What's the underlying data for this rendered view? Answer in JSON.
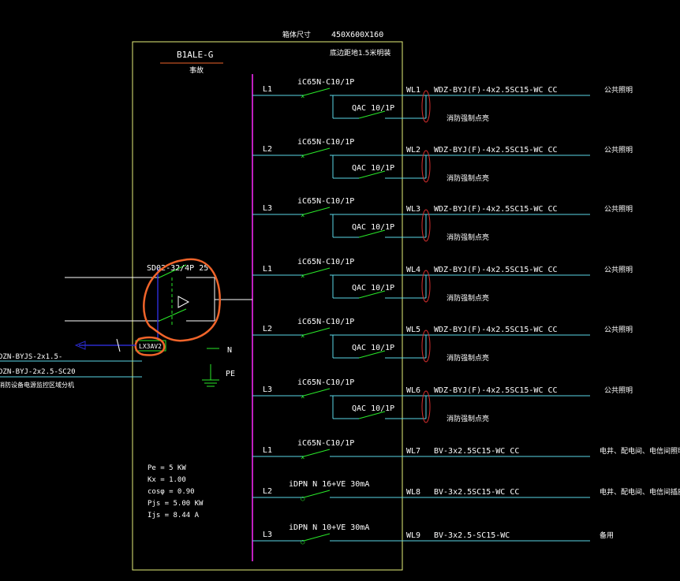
{
  "colors": {
    "background": "#000000",
    "frame": "#e6f07a",
    "busbar": "#c020c0",
    "breaker": "#29e829",
    "cable": "#5ad6e6",
    "oval": "#d93030",
    "annotation": "#f0642a",
    "incoming": "#2a2acc",
    "text": "#ffffff"
  },
  "header": {
    "box_size_label": "箱体尺寸",
    "box_size_value": "450X600X160",
    "mounting": "底边距地1.5米明装"
  },
  "panel": {
    "id": "B1ALE-G",
    "subtitle": "事故"
  },
  "main_switch": {
    "label": "SD02-32/4P  25",
    "tag": "LX3AV2"
  },
  "labels": {
    "neutral": "N",
    "earth": "PE"
  },
  "incoming": {
    "line1": "DZN-BYJS-2x1.5-",
    "line2": "DZN-BYJ-2x2.5-SC20",
    "line3": "消防设备电源监控区域分机"
  },
  "load_calc": [
    "Pe = 5 KW",
    "Kx = 1.00",
    "cosφ = 0.90",
    "Pjs = 5.00 KW",
    "Ijs = 8.44 A"
  ],
  "circuits": [
    {
      "phase": "L1",
      "breaker": "iC65N-C10/1P",
      "contactor": "QAC 10/1P",
      "contactor_note": "消防强制点亮",
      "wl": "WL1",
      "cable": "WDZ-BYJ(F)-4x2.5SC15-WC CC",
      "load": "公共照明"
    },
    {
      "phase": "L2",
      "breaker": "iC65N-C10/1P",
      "contactor": "QAC 10/1P",
      "contactor_note": "消防强制点亮",
      "wl": "WL2",
      "cable": "WDZ-BYJ(F)-4x2.5SC15-WC CC",
      "load": "公共照明"
    },
    {
      "phase": "L3",
      "breaker": "iC65N-C10/1P",
      "contactor": "QAC 10/1P",
      "contactor_note": "消防强制点亮",
      "wl": "WL3",
      "cable": "WDZ-BYJ(F)-4x2.5SC15-WC CC",
      "load": "公共照明"
    },
    {
      "phase": "L1",
      "breaker": "iC65N-C10/1P",
      "contactor": "QAC 10/1P",
      "contactor_note": "消防强制点亮",
      "wl": "WL4",
      "cable": "WDZ-BYJ(F)-4x2.5SC15-WC CC",
      "load": "公共照明"
    },
    {
      "phase": "L2",
      "breaker": "iC65N-C10/1P",
      "contactor": "QAC 10/1P",
      "contactor_note": "消防强制点亮",
      "wl": "WL5",
      "cable": "WDZ-BYJ(F)-4x2.5SC15-WC CC",
      "load": "公共照明"
    },
    {
      "phase": "L3",
      "breaker": "iC65N-C10/1P",
      "contactor": "QAC 10/1P",
      "contactor_note": "消防强制点亮",
      "wl": "WL6",
      "cable": "WDZ-BYJ(F)-4x2.5SC15-WC CC",
      "load": "公共照明"
    },
    {
      "phase": "L1",
      "breaker": "iC65N-C10/1P",
      "contactor": "",
      "contactor_note": "",
      "wl": "WL7",
      "cable": "BV-3x2.5SC15-WC CC",
      "load": "电井、配电间、电信间照明"
    },
    {
      "phase": "L2",
      "breaker": "iDPN N 16+VE 30mA",
      "contactor": "",
      "contactor_note": "",
      "wl": "WL8",
      "cable": "BV-3x2.5SC15-WC CC",
      "load": "电井、配电间、电信间插座"
    },
    {
      "phase": "L3",
      "breaker": "iDPN N 10+VE 30mA",
      "contactor": "",
      "contactor_note": "",
      "wl": "WL9",
      "cable": "BV-3x2.5-SC15-WC",
      "load": "备用"
    }
  ]
}
